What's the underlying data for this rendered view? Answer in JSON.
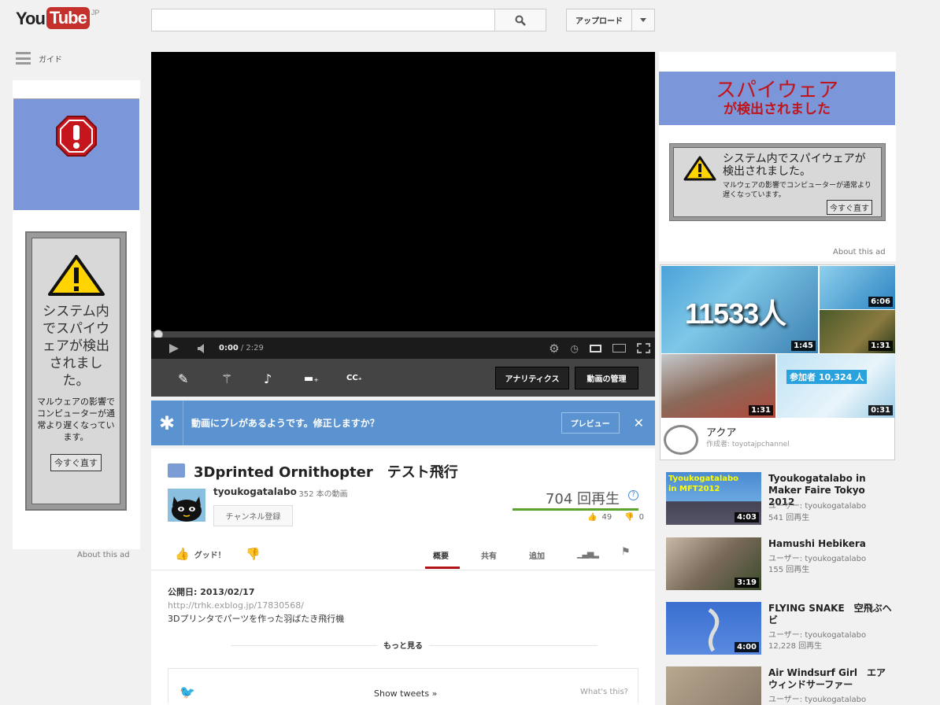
{
  "header": {
    "logo_you": "You",
    "logo_tube": "Tube",
    "logo_region": "JP",
    "search_placeholder": "",
    "upload_label": "アップロード"
  },
  "guide": {
    "label": "ガイド"
  },
  "left_ad": {
    "warning_title": "システム内でスパイウェアが検出されました。",
    "warning_body": "マルウェアの影響でコンピューターが通常より遅くなっています。",
    "fix_button": "今すぐ直す",
    "about": "About this ad"
  },
  "player": {
    "time_current": "0:00",
    "time_total": "/ 2:29",
    "analytics_button": "アナリティクス",
    "manage_button": "動画の管理"
  },
  "banner": {
    "message": "動画にブレがあるようです。修正しますか？",
    "preview_button": "プレビュー"
  },
  "video": {
    "title": "3Dprinted Ornithopter　テスト飛行",
    "channel": "tyoukogatalabo",
    "channel_videos": "· 352 本の動画",
    "subscribe": "チャンネル登録",
    "views": "704 回再生",
    "likes": "49",
    "dislikes": "0",
    "like_label": "グッド！",
    "tabs": [
      "概要",
      "共有",
      "追加"
    ],
    "published": "公開日: 2013/02/17",
    "link": "http://trhk.exblog.jp/17830568/",
    "description": "3Dプリンタでパーツを作った羽ばたき飛行機",
    "show_more": "もっと見る",
    "show_tweets": "Show tweets",
    "whats_this": "What's this?"
  },
  "right_ad": {
    "headline1": "スパイウェア",
    "headline2": "が検出されました",
    "popup_title": "システム内でスパイウェアが検出されました。",
    "popup_body": "マルウェアの影響でコンピューターが通常より遅くなっています。",
    "popup_button": "今すぐ直す",
    "about": "About this ad"
  },
  "featured": {
    "counter": "11533人",
    "participants": "参加者 10,324 人",
    "durations": [
      "6:06",
      "1:45",
      "1:31",
      "1:31",
      "0:31"
    ],
    "channel_title": "アクア",
    "channel_by": "作成者: toyotajpchannel"
  },
  "related": [
    {
      "title": "Tyoukogatalabo in Maker Faire Tokyo　2012",
      "user": "ユーザー: tyoukogatalabo",
      "views": "541 回再生",
      "duration": "4:03",
      "thumb_text": "Tyoukogatalabo in MFT2012"
    },
    {
      "title": "Hamushi Hebikera",
      "user": "ユーザー: tyoukogatalabo",
      "views": "155 回再生",
      "duration": "3:19"
    },
    {
      "title": "FLYING SNAKE　空飛ぶヘビ",
      "user": "ユーザー: tyoukogatalabo",
      "views": "12,228 回再生",
      "duration": "4:00"
    },
    {
      "title": "Air Windsurf Girl　エアウィンドサーファー",
      "user": "ユーザー: tyoukogatalabo",
      "views": "",
      "duration": ""
    }
  ]
}
